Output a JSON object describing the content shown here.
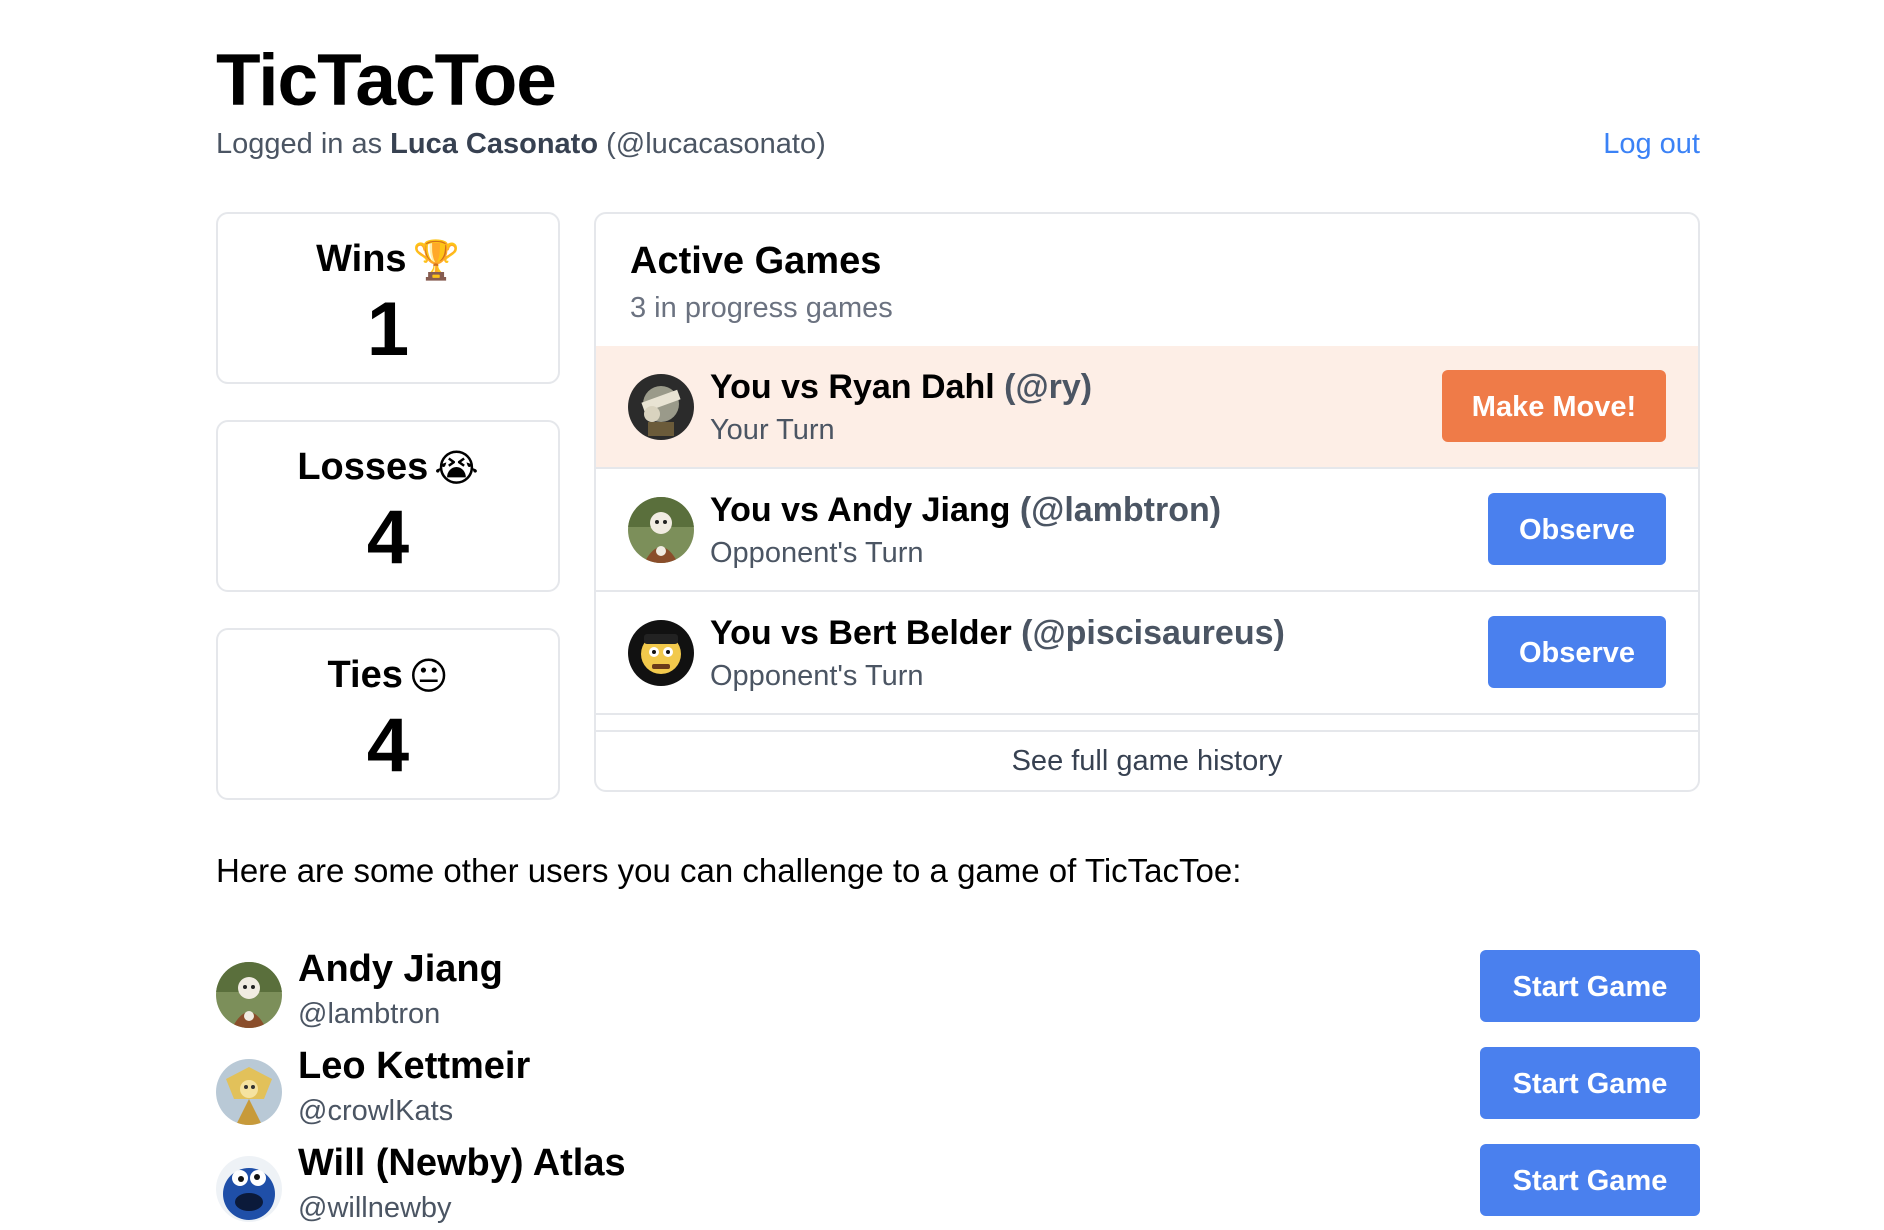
{
  "app": {
    "title": "TicTacToe"
  },
  "session": {
    "prefix": "Logged in as",
    "name": "Luca Casonato",
    "handle": "(@lucacasonato)",
    "logout_label": "Log out"
  },
  "stats": [
    {
      "label": "Wins",
      "emoji": "🏆",
      "value": "1"
    },
    {
      "label": "Losses",
      "emoji": "😭",
      "value": "4"
    },
    {
      "label": "Ties",
      "emoji": "😐",
      "value": "4"
    }
  ],
  "active_games": {
    "title": "Active Games",
    "subtitle": "3 in progress games",
    "games": [
      {
        "vs": "You vs Ryan Dahl",
        "handle": "(@ry)",
        "status": "Your Turn",
        "action": "Make Move!",
        "avatar": "avatar-ryan-dahl"
      },
      {
        "vs": "You vs Andy Jiang",
        "handle": "(@lambtron)",
        "status": "Opponent's Turn",
        "action": "Observe",
        "avatar": "avatar-andy-jiang"
      },
      {
        "vs": "You vs Bert Belder",
        "handle": "(@piscisaureus)",
        "status": "Opponent's Turn",
        "action": "Observe",
        "avatar": "avatar-bert-belder"
      }
    ],
    "history_link": "See full game history"
  },
  "challenge": {
    "intro": "Here are some other users you can challenge to a game of TicTacToe:",
    "users": [
      {
        "name": "Andy Jiang",
        "handle": "@lambtron",
        "action": "Start Game",
        "avatar": "avatar-andy-jiang"
      },
      {
        "name": "Leo Kettmeir",
        "handle": "@crowlKats",
        "action": "Start Game",
        "avatar": "avatar-leo-kettmeir"
      },
      {
        "name": "Will (Newby) Atlas",
        "handle": "@willnewby",
        "action": "Start Game",
        "avatar": "avatar-will-atlas"
      }
    ]
  },
  "colors": {
    "accent_blue": "#4a80ee",
    "accent_orange": "#ef7b48",
    "highlight_row": "#fdeee6",
    "link": "#3b82f6"
  }
}
